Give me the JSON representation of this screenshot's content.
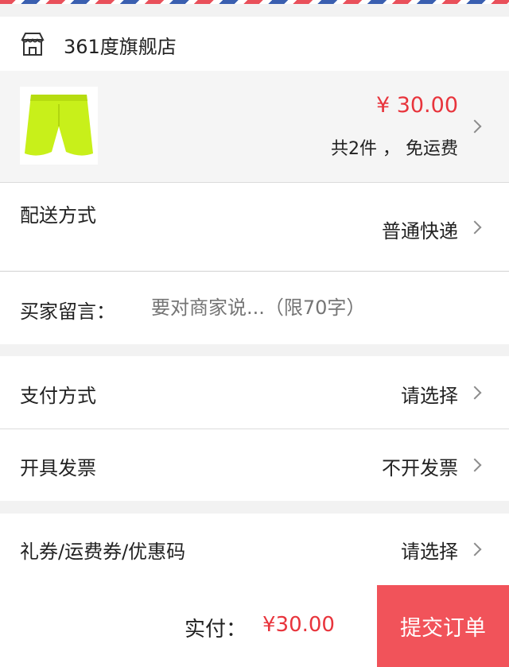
{
  "store": {
    "name": "361度旗舰店",
    "icon": "store-icon"
  },
  "product": {
    "image_icon": "green-shorts-image",
    "price": "¥ 30.00",
    "summary": "共2件 ， 免运费"
  },
  "delivery": {
    "label": "配送方式",
    "value": "普通快递"
  },
  "message": {
    "label": "买家留言：",
    "placeholder": "要对商家说...（限70字）"
  },
  "payment": {
    "label": "支付方式",
    "value": "请选择"
  },
  "invoice": {
    "label": "开具发票",
    "value": "不开发票"
  },
  "coupon": {
    "label": "礼券/运费券/优惠码",
    "value": "请选择"
  },
  "footer": {
    "total_label": "实付：",
    "total_value": "¥30.00",
    "submit_label": "提交订单"
  },
  "colors": {
    "accent_red": "#e8343c",
    "submit_bg": "#f1535a",
    "product_green": "#c8f01a"
  }
}
